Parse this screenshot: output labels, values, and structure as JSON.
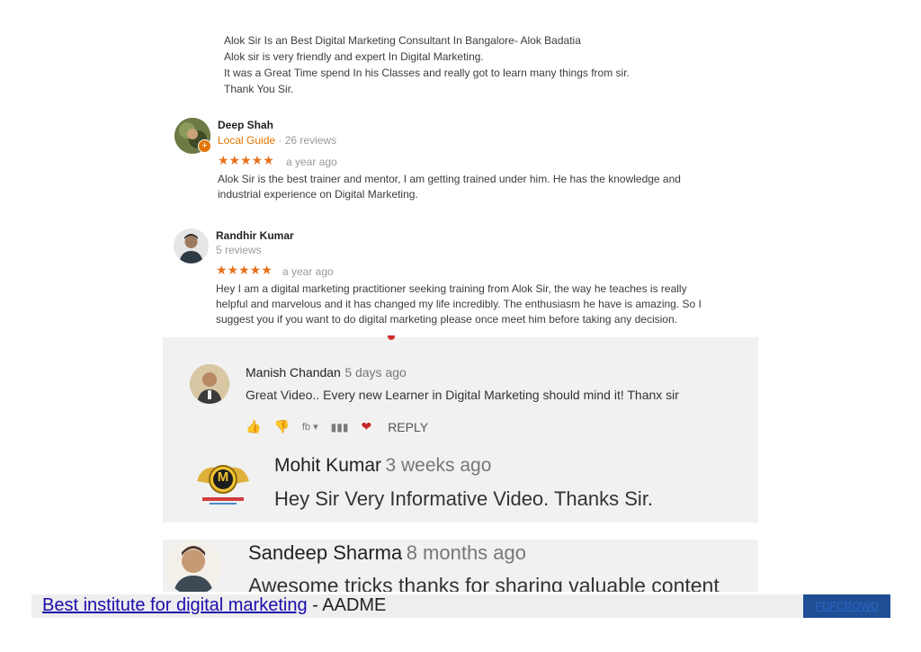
{
  "review0": {
    "lines": [
      "Alok Sir Is an Best Digital Marketing Consultant In Bangalore- Alok Badatia",
      "Alok sir is very friendly and expert In Digital Marketing.",
      "It was a Great Time spend In his Classes and really got to learn many things from sir.",
      "Thank You Sir."
    ]
  },
  "review1": {
    "name": "Deep Shah",
    "guide": "Local Guide",
    "reviews": " · 26 reviews",
    "stars": "★★★★★",
    "time": "a year ago",
    "lines": [
      "Alok Sir is the best trainer and mentor, I am getting trained under him. He has the knowledge and",
      "industrial experience on Digital Marketing."
    ]
  },
  "review2": {
    "name": "Randhir Kumar",
    "reviews": "5 reviews",
    "stars": "★★★★★",
    "time": "a year ago",
    "lines": [
      "Hey I am a digital marketing practitioner seeking training from Alok Sir, the way he teaches is really",
      "helpful and marvelous and it has changed my life incredibly. The enthusiasm he have is amazing. So I",
      "suggest you if you want to do digital marketing please once meet him before taking any decision."
    ]
  },
  "yt1": {
    "name": "Manish Chandan",
    "time": "5 days ago",
    "text": "Great Video.. Every new Learner in Digital Marketing should mind it! Thanx sir",
    "reply": "REPLY"
  },
  "yt2": {
    "name": "Mohit Kumar",
    "time": "3 weeks ago",
    "text": "Hey Sir Very Informative Video. Thanks Sir.",
    "avatar_letter": "M"
  },
  "yt3": {
    "name": "Sandeep Sharma",
    "time": "8 months ago",
    "text": "Awesome tricks thanks for sharing valuable content"
  },
  "footer": {
    "link": "Best institute for digital marketing",
    "rest": " - AADME",
    "badge": "PDFCROWD"
  },
  "colors": {
    "star": "#e7711b",
    "guide": "#e37400",
    "link": "#1a0dab",
    "badge": "#1f4e94"
  }
}
